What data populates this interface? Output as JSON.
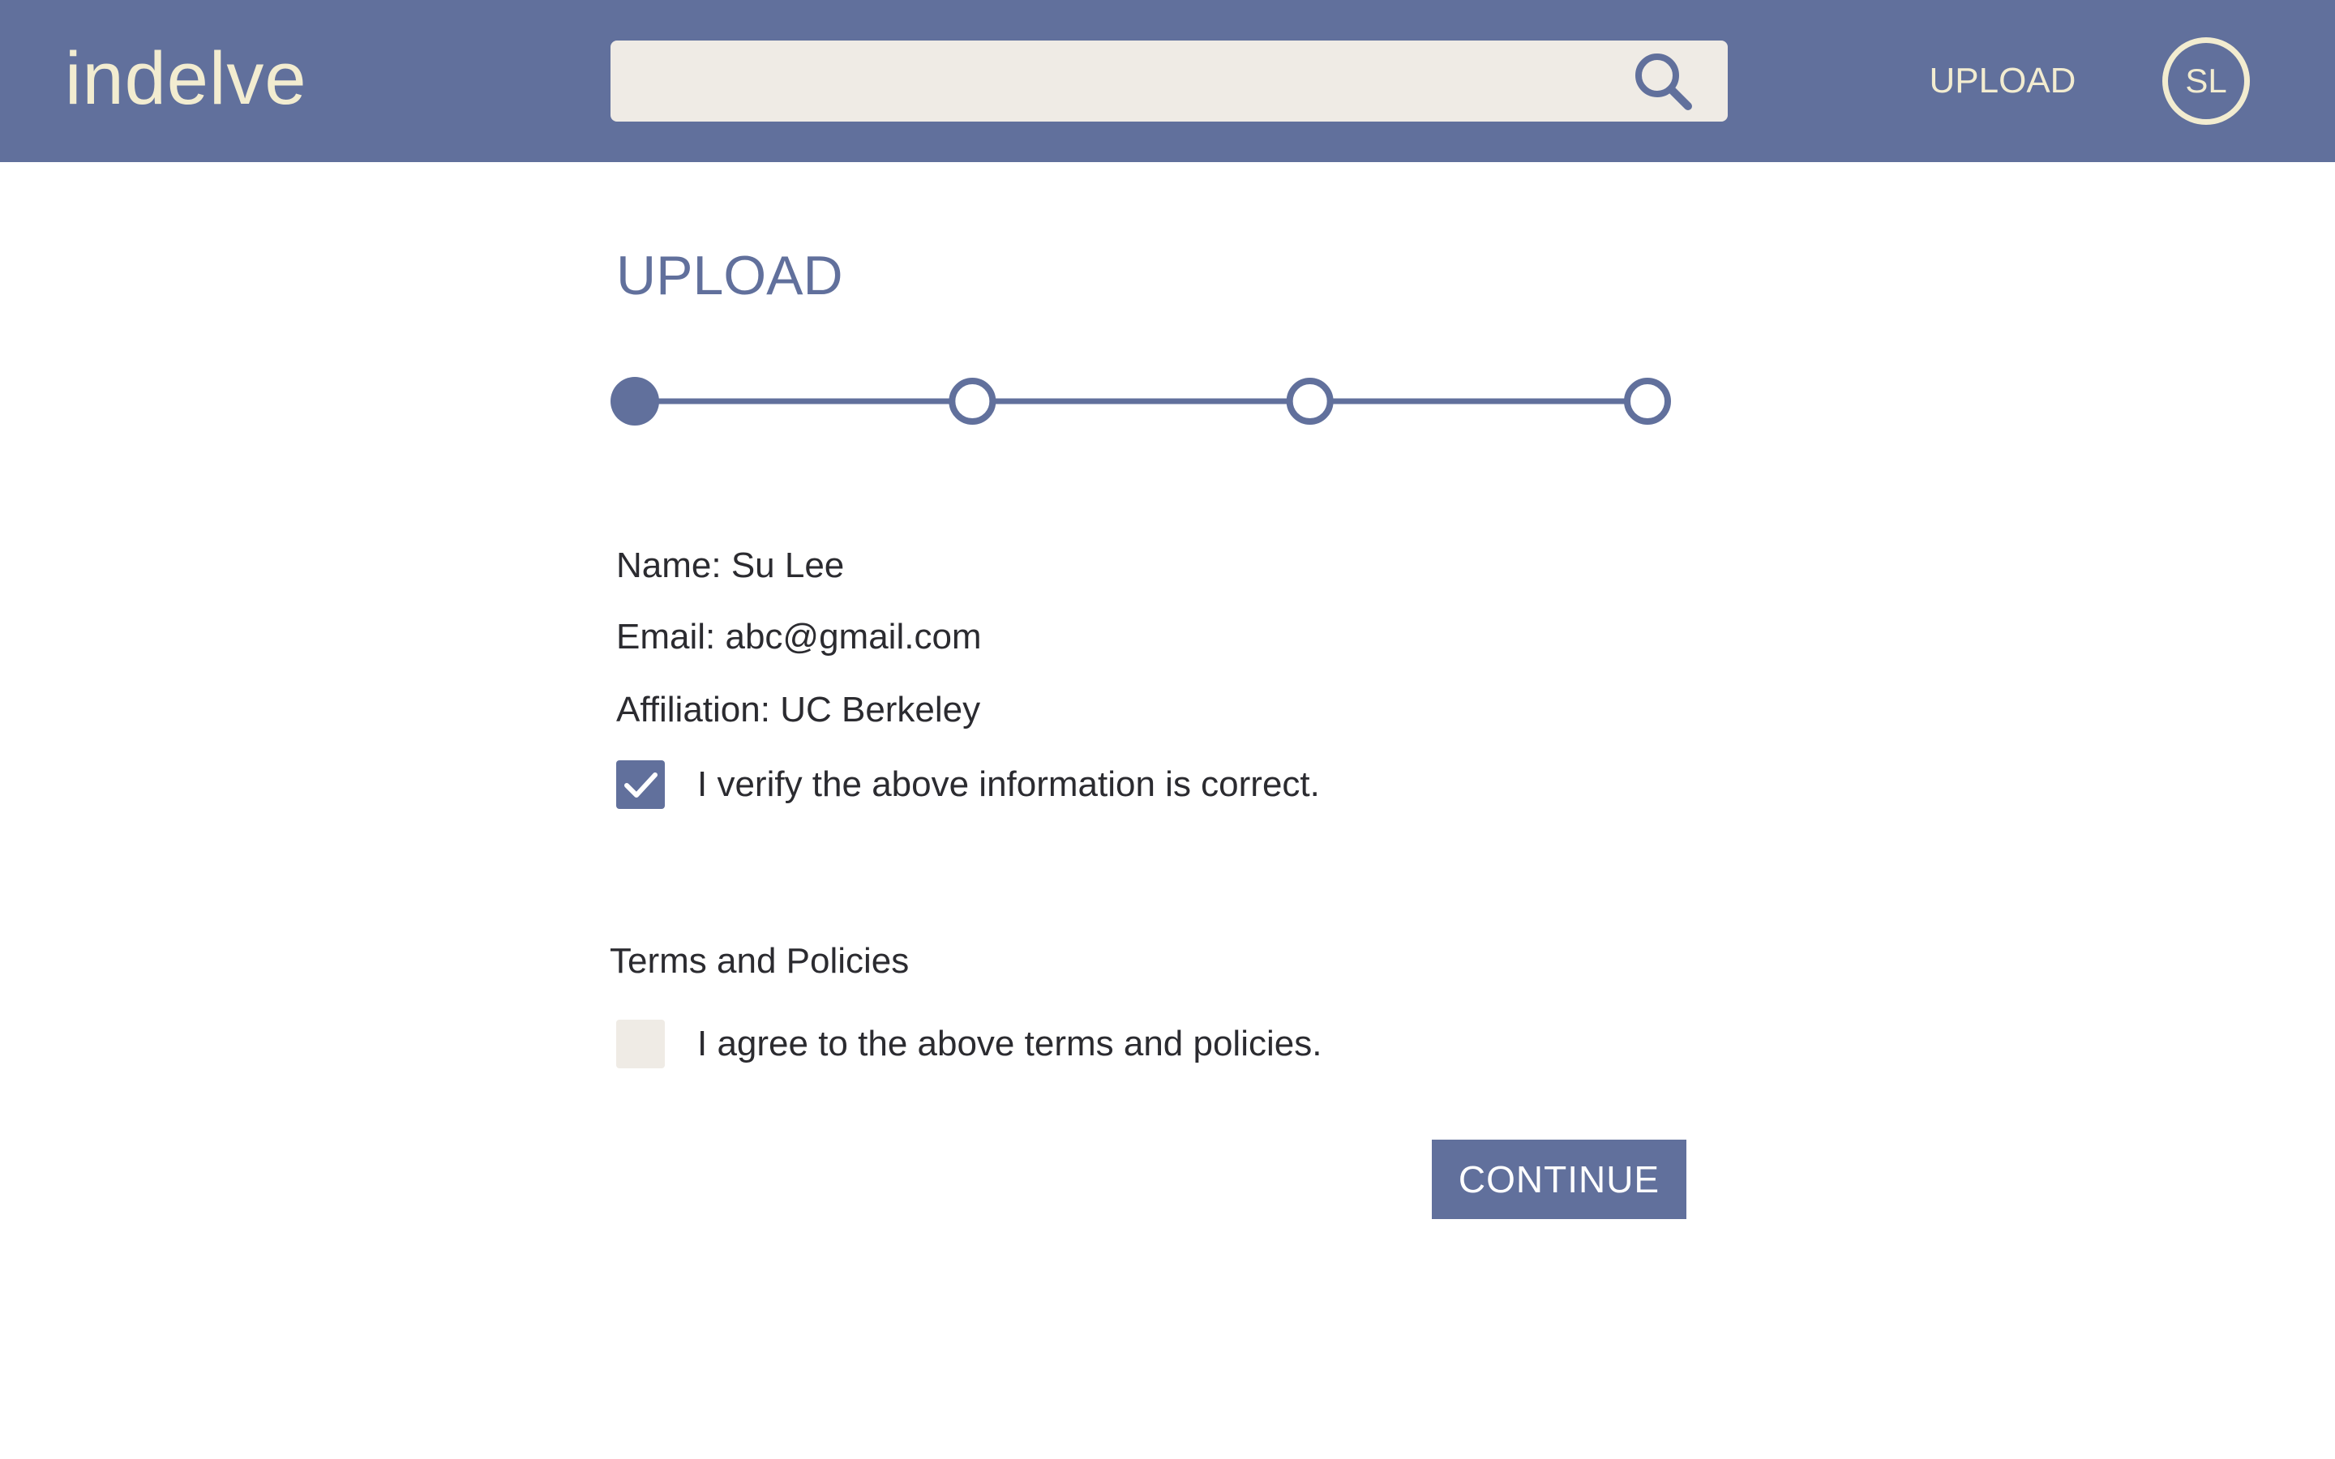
{
  "app": {
    "logo": "indelve"
  },
  "header": {
    "search_placeholder": "",
    "search_icon": "search-icon",
    "upload_label": "UPLOAD",
    "avatar_initials": "SL"
  },
  "main": {
    "title": "UPLOAD",
    "stepper": {
      "total_steps": 4,
      "current_step": 1
    },
    "info": {
      "name": "Name: Su Lee",
      "email": "Email: abc@gmail.com",
      "affiliation": "Affiliation: UC Berkeley"
    },
    "verify": {
      "checked": true,
      "label": "I verify the above information is correct."
    },
    "terms": {
      "heading": "Terms and Policies",
      "checked": false,
      "label": "I agree to the above terms and policies."
    },
    "continue_label": "CONTINUE"
  },
  "colors": {
    "primary": "#61709c",
    "cream": "#f2ecd0",
    "input_bg": "#efebe5",
    "text": "#2b2b30"
  }
}
